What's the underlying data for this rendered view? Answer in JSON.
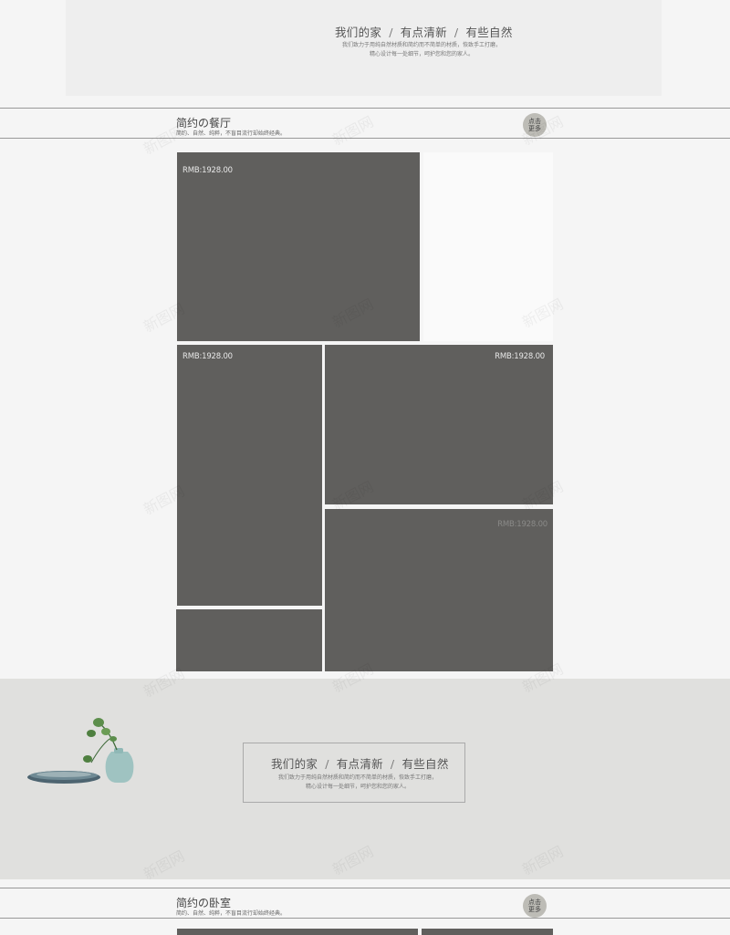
{
  "banner": {
    "slogan": [
      "我们的家",
      "有点清新",
      "有些自然"
    ],
    "separator": "/",
    "desc_line1": "我们致力于用纯自然材质和简约而不简单的材质，恢致手工打磨，",
    "desc_line2": "精心设计每一处细节，呵护您和您的家人。"
  },
  "dining": {
    "title": "简约の餐厅",
    "subtitle": "简约、自然、纯粹，不盲目流行却始终经典。",
    "more_line1": "点击",
    "more_line2": "更多"
  },
  "products": {
    "price1": "RMB:1928.00",
    "price2": "RMB:1928.00",
    "price3": "RMB:1928.00",
    "price4": "RMB:1928.00"
  },
  "band": {
    "slogan": [
      "我们的家",
      "有点清新",
      "有些自然"
    ],
    "separator": "/",
    "desc_line1": "我们致力于用纯自然材质和简约而不简单的材质，恢致手工打磨，",
    "desc_line2": "精心设计每一处细节，呵护您和您的家人。"
  },
  "bedroom": {
    "title": "简约の卧室",
    "subtitle": "简约、自然、纯粹，不盲目流行却始终经典。",
    "more_line1": "点击",
    "more_line2": "更多"
  },
  "watermark": "新图网",
  "colors": {
    "tile": "#605f5d",
    "band": "#e0e0de",
    "button": "#bdbcb6"
  }
}
